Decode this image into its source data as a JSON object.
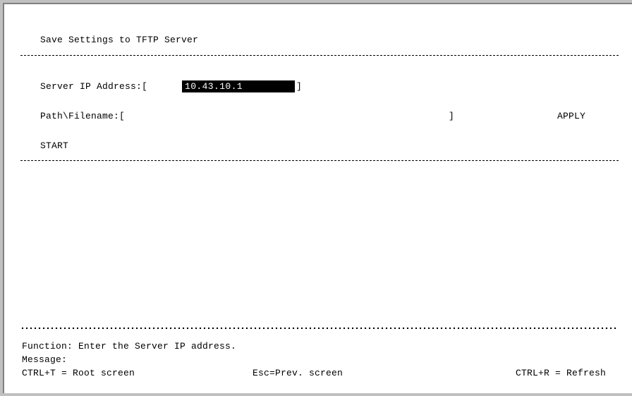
{
  "screen": {
    "title": "Save Settings to TFTP Server",
    "server_ip_label": "Server IP Address:[",
    "server_ip_value": "10.43.10.1",
    "server_ip_close": "]",
    "path_label": "Path\\Filename:[",
    "path_value": "",
    "path_close": "]",
    "apply_label": "APPLY",
    "start_label": "START"
  },
  "footer": {
    "function_label": "Function:",
    "function_text": "Enter the Server IP address.",
    "message_label": "Message:",
    "message_text": "",
    "root_hint": "CTRL+T = Root screen",
    "prev_hint": "Esc=Prev. screen",
    "refresh_hint": "CTRL+R = Refresh"
  }
}
